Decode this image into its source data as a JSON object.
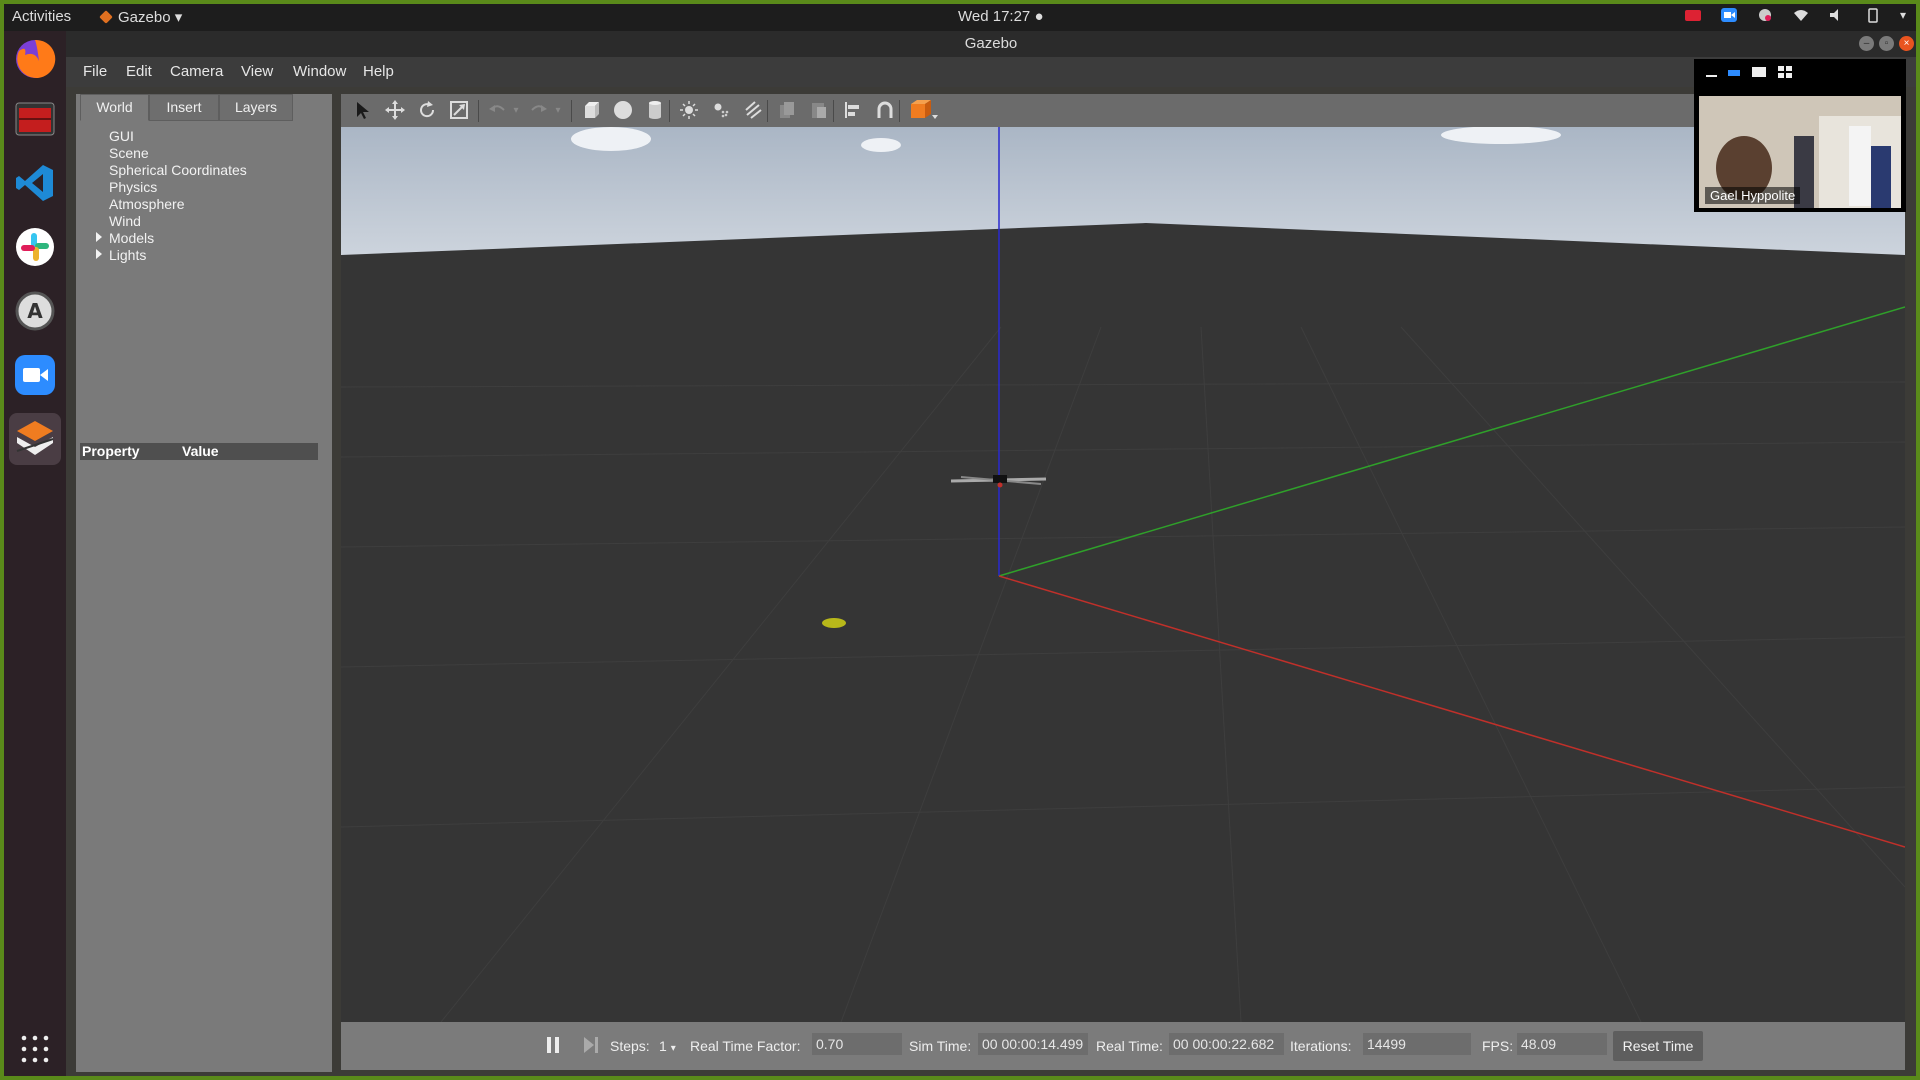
{
  "system_bar": {
    "activities": "Activities",
    "app_name": "Gazebo",
    "clock": "Wed 17:27 ●"
  },
  "window": {
    "title": "Gazebo"
  },
  "menu": [
    "File",
    "Edit",
    "Camera",
    "View",
    "Window",
    "Help"
  ],
  "left_panel": {
    "tabs": [
      "World",
      "Insert",
      "Layers"
    ],
    "active_tab": "World",
    "tree": [
      {
        "label": "GUI",
        "expandable": false
      },
      {
        "label": "Scene",
        "expandable": false
      },
      {
        "label": "Spherical Coordinates",
        "expandable": false
      },
      {
        "label": "Physics",
        "expandable": false
      },
      {
        "label": "Atmosphere",
        "expandable": false
      },
      {
        "label": "Wind",
        "expandable": false
      },
      {
        "label": "Models",
        "expandable": true
      },
      {
        "label": "Lights",
        "expandable": true
      }
    ],
    "property_header": {
      "property": "Property",
      "value": "Value"
    }
  },
  "toolbar": {
    "icons": [
      "select-arrow-icon",
      "translate-icon",
      "rotate-icon",
      "scale-icon",
      "undo-icon",
      "undo-dropdown-icon",
      "redo-icon",
      "redo-dropdown-icon",
      "box-icon",
      "sphere-icon",
      "cylinder-icon",
      "point-light-icon",
      "spot-light-icon",
      "directional-light-icon",
      "copy-icon",
      "paste-icon",
      "align-icon",
      "snap-icon",
      "view-angle-icon"
    ]
  },
  "status": {
    "steps_label": "Steps:",
    "steps_value": "1",
    "rtf_label": "Real Time Factor:",
    "rtf_value": "0.70",
    "sim_time_label": "Sim Time:",
    "sim_time_value": "00 00:00:14.499",
    "real_time_label": "Real Time:",
    "real_time_value": "00 00:00:22.682",
    "iterations_label": "Iterations:",
    "iterations_value": "14499",
    "fps_label": "FPS:",
    "fps_value": "48.09",
    "reset_label": "Reset Time"
  },
  "pip": {
    "participant_name": "Gael Hyppolite"
  },
  "colors": {
    "desktop_border": "#5a8a1a",
    "axis_x": "#c0302a",
    "axis_y": "#2fa02a",
    "axis_z": "#2a2ad0",
    "viewport_ground": "#353535"
  }
}
